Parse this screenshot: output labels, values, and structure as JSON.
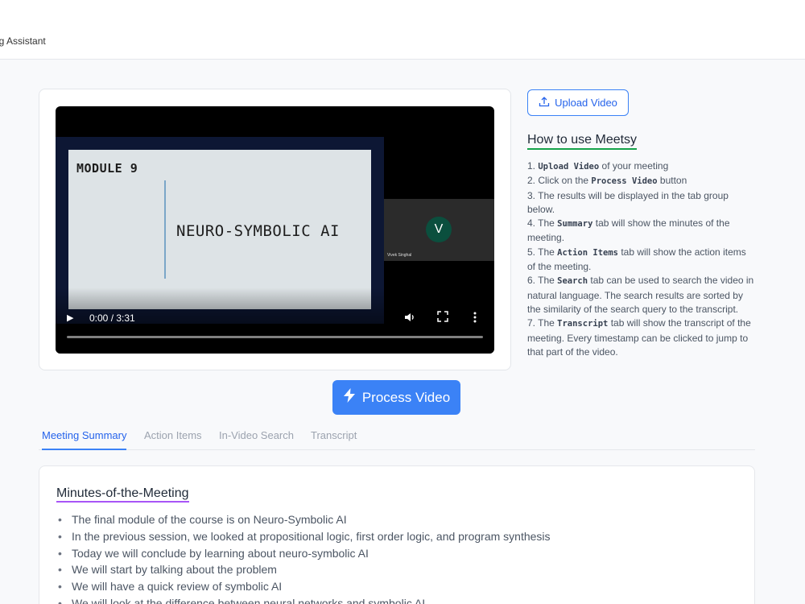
{
  "app": {
    "title": "ng Assistant"
  },
  "player": {
    "slide_module": "MODULE 9",
    "slide_title": "NEURO-SYMBOLIC AI",
    "participant_initial": "V",
    "participant_name": "Vivek Singhal",
    "time": "0:00 / 3:31",
    "progress": 0
  },
  "upload": {
    "label": "Upload Video"
  },
  "howto": {
    "title": "How to use Meetsy",
    "steps": [
      {
        "pre": "1. ",
        "code": "Upload Video",
        "post": " of your meeting"
      },
      {
        "pre": "2. Click on the ",
        "code": "Process Video",
        "post": " button"
      },
      {
        "pre": "3. The results will be displayed in the tab group below.",
        "code": "",
        "post": ""
      },
      {
        "pre": "4. The ",
        "code": "Summary",
        "post": " tab will show the minutes of the meeting."
      },
      {
        "pre": "5. The ",
        "code": "Action Items",
        "post": " tab will show the action items of the meeting."
      },
      {
        "pre": "6. The ",
        "code": "Search",
        "post": " tab can be used to search the video in natural language. The search results are sorted by the similarity of the search query to the transcript."
      },
      {
        "pre": "7. The ",
        "code": "Transcript",
        "post": " tab will show the transcript of the meeting. Every timestamp can be clicked to jump to that part of the video."
      }
    ]
  },
  "process": {
    "label": "Process Video"
  },
  "tabs": [
    "Meeting Summary",
    "Action Items",
    "In-Video Search",
    "Transcript"
  ],
  "summary": {
    "title": "Minutes-of-the-Meeting",
    "bullets": [
      "The final module of the course is on Neuro-Symbolic AI",
      "In the previous session, we looked at propositional logic, first order logic, and program synthesis",
      "Today we will conclude by learning about neuro-symbolic AI",
      "We will start by talking about the problem",
      "We will have a quick review of symbolic AI",
      "We will look at the difference between neural networks and symbolic AI"
    ]
  },
  "colors": {
    "accent": "#3b82f6",
    "howto_underline": "#16a34a",
    "minutes_underline": "#a855f7"
  }
}
